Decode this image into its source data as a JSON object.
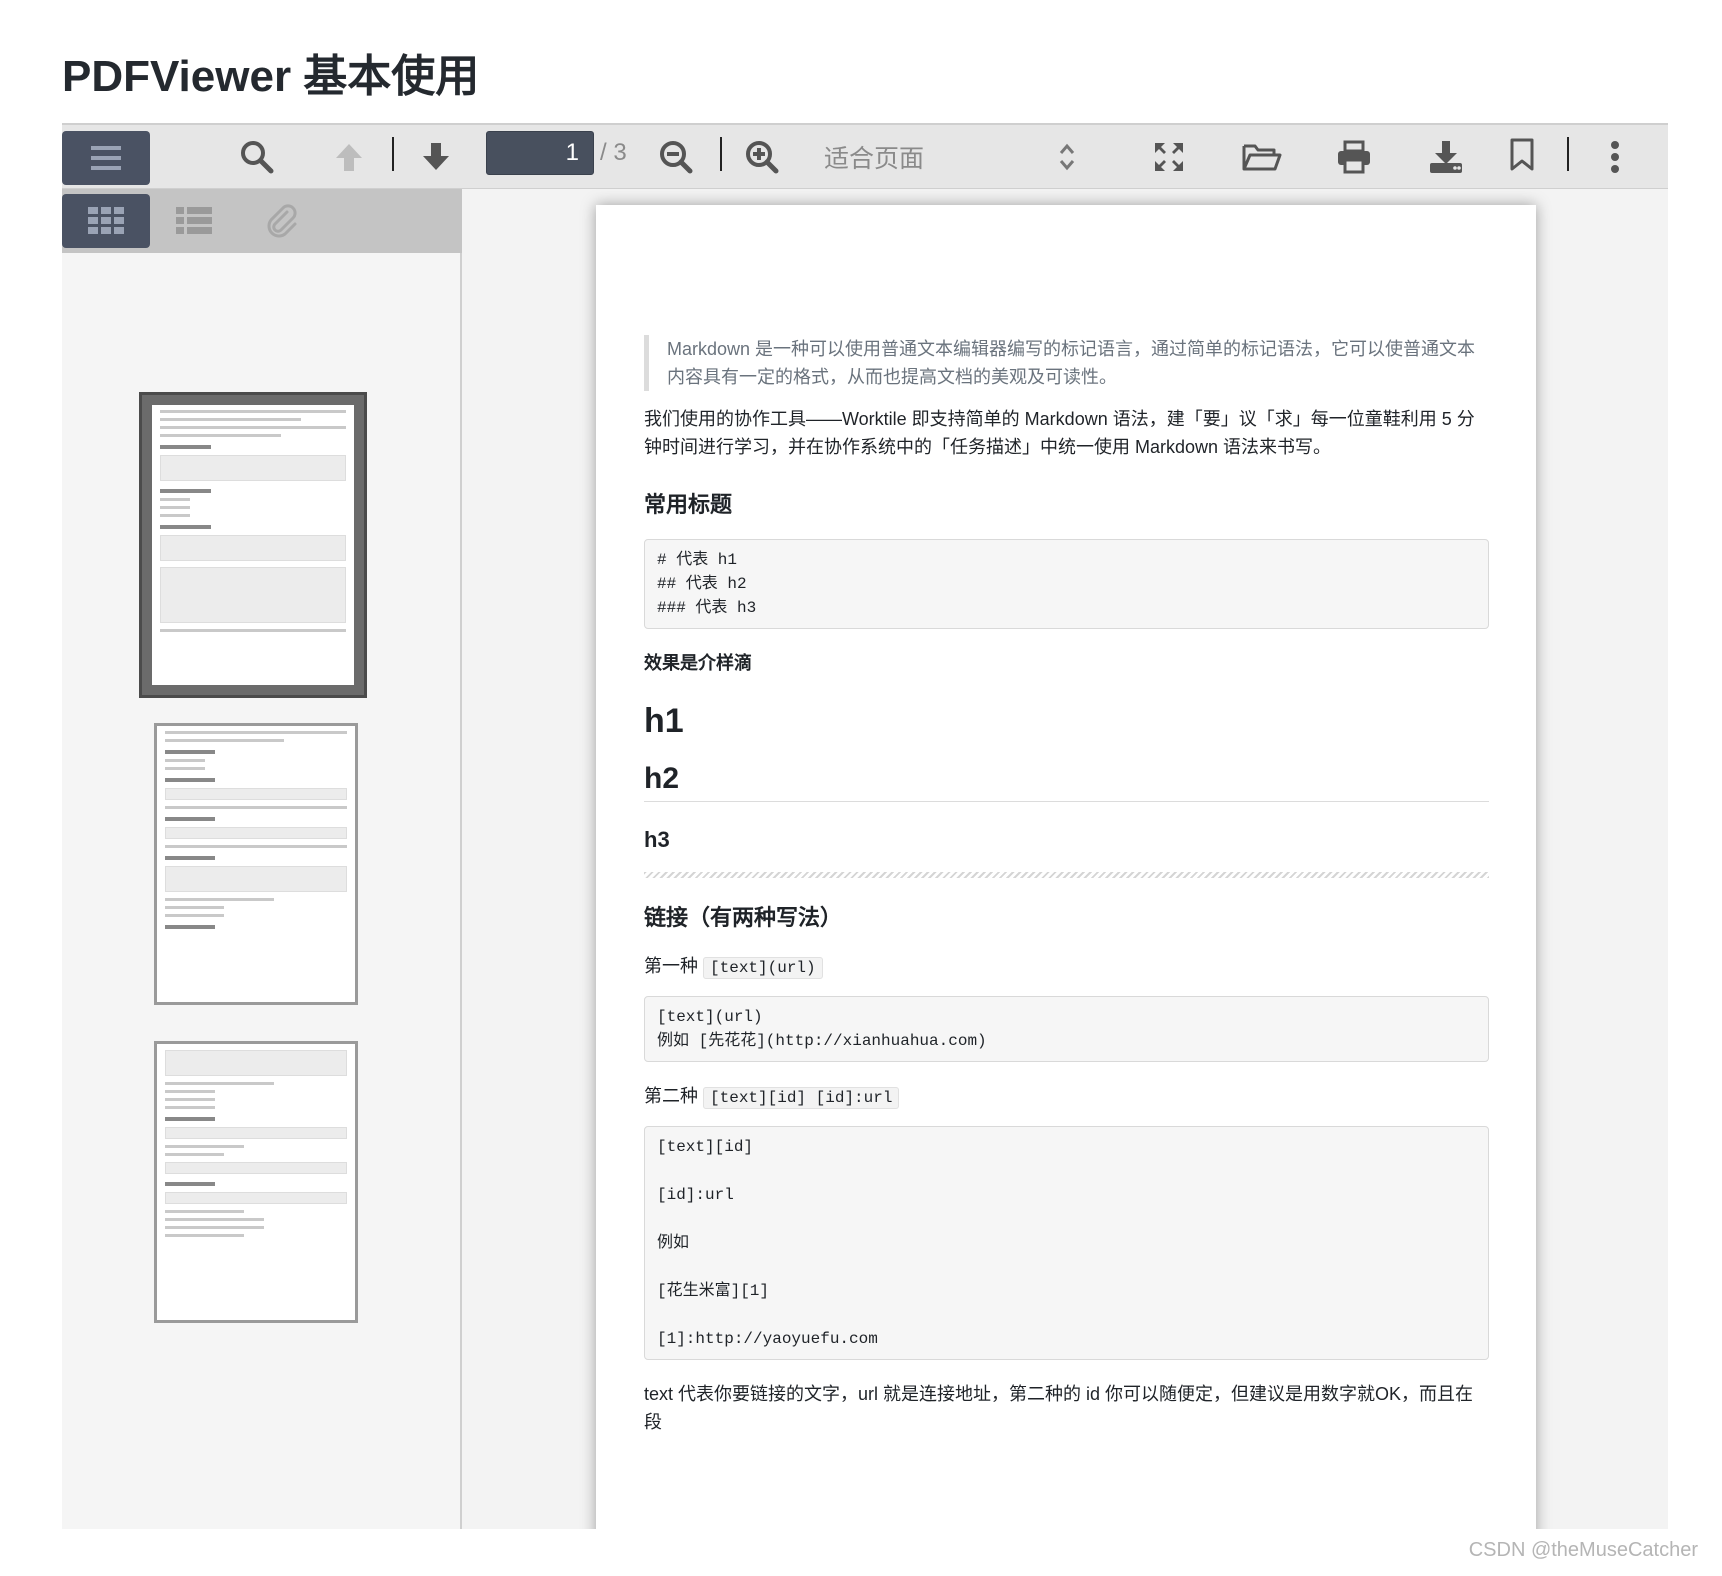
{
  "page_title": "PDFViewer 基本使用",
  "toolbar": {
    "page_number": "1",
    "page_count": "/ 3",
    "zoom": "适合页面"
  },
  "document": {
    "quote": "Markdown 是一种可以使用普通文本编辑器编写的标记语言，通过简单的标记语法，它可以使普通文本内容具有一定的格式，从而也提高文档的美观及可读性。",
    "intro": "我们使用的协作工具——Worktile 即支持简单的 Markdown 语法，建「要」议「求」每一位童鞋利用 5 分钟时间进行学习，并在协作系统中的「任务描述」中统一使用 Markdown 语法来书写。",
    "headings_title": "常用标题",
    "headings_code": "# 代表 h1\n## 代表 h2\n### 代表 h3",
    "effect_label": "效果是介样滴",
    "h1": "h1",
    "h2": "h2",
    "h3": "h3",
    "links_title": "链接（有两种写法）",
    "link1_label": "第一种",
    "link1_inline": "[text](url)",
    "link1_code": "[text](url)\n例如 [先花花](http://xianhuahua.com)",
    "link2_label": "第二种",
    "link2_inline": "[text][id] [id]:url",
    "link2_code": "[text][id]\n\n[id]:url\n\n例如\n\n[花生米富][1]\n\n[1]:http://yaoyuefu.com",
    "closing": "text 代表你要链接的文字，url 就是连接地址，第二种的 id 你可以随便定，但建议是用数字就OK，而且在段"
  },
  "watermark": "CSDN @theMuseCatcher"
}
